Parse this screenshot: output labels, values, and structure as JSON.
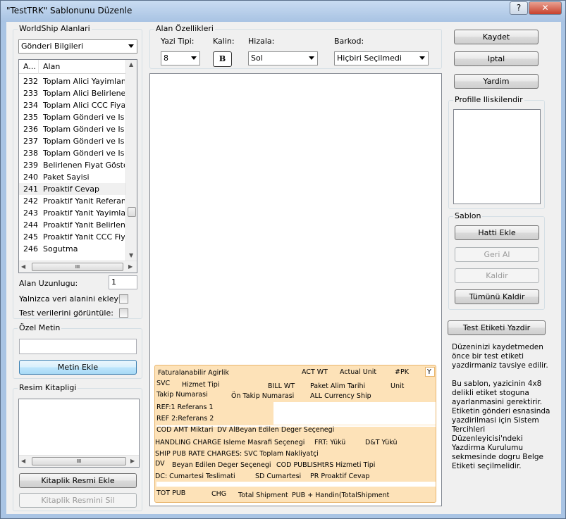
{
  "window": {
    "title": "\"TestTRK\" Sablonunu Düzenle",
    "help_btn": "?",
    "close_btn": "✕"
  },
  "worldship": {
    "group_label": "WorldShip Alanlari",
    "dropdown_value": "Gönderi Bilgileri",
    "list": {
      "col_num": "A...",
      "col_name": "Alan",
      "rows": [
        {
          "num": "232",
          "name": "Toplam Alici Yayimlanmi..."
        },
        {
          "num": "233",
          "name": "Toplam Alici Belirlenen F"
        },
        {
          "num": "234",
          "name": "Toplam Alici CCC Fiyatla"
        },
        {
          "num": "235",
          "name": "Toplam Gönderi ve Isle..."
        },
        {
          "num": "236",
          "name": "Toplam Gönderi ve Isle..."
        },
        {
          "num": "237",
          "name": "Toplam Gönderi ve Isle..."
        },
        {
          "num": "238",
          "name": "Toplam Gönderi ve Isle..."
        },
        {
          "num": "239",
          "name": "Belirlenen Fiyat Gösterge"
        },
        {
          "num": "240",
          "name": "Paket Sayisi"
        },
        {
          "num": "241",
          "name": "Proaktif Cevap"
        },
        {
          "num": "242",
          "name": "Proaktif Yanit Referans ..."
        },
        {
          "num": "243",
          "name": "Proaktif Yanit Yayimlanm"
        },
        {
          "num": "244",
          "name": "Proaktif Yanit Belirlenen"
        },
        {
          "num": "245",
          "name": "Proaktif Yanit CCC Fiyatl"
        },
        {
          "num": "246",
          "name": "Sogutma"
        }
      ]
    },
    "hscroll_grip": "III",
    "length_label": "Alan Uzunlugu:",
    "length_value": "1",
    "data_only_label": "Yalnizca veri alanini ekleyin:",
    "show_test_label": "Test verilerini görüntüle:"
  },
  "custom_text": {
    "group_label": "Özel Metin",
    "value": "",
    "add_button": "Metin Ekle"
  },
  "image_library": {
    "group_label": "Resim Kitapligi",
    "hscroll_grip": "III",
    "add_button": "Kitaplik Resmi Ekle",
    "delete_button": "Kitaplik Resmini Sil"
  },
  "field_props": {
    "group_label": "Alan Özellikleri",
    "font_label": "Yazi Tipi:",
    "font_value": "8",
    "bold_label": "Kalin:",
    "bold_glyph": "B",
    "align_label": "Hizala:",
    "align_value": "Sol",
    "barcode_label": "Barkod:",
    "barcode_value": "Hiçbiri Seçilmedi"
  },
  "label_fields": [
    "Faturalanabilir Agirlik",
    "ACT WT",
    "Actual Unit",
    "#PK",
    "Y",
    "SVC",
    "Hizmet Tipi",
    "BILL WT",
    "Paket Alim Tarihi",
    "Unit",
    "Takip Numarasi",
    "Ön Takip Numarasi",
    "ALL Currency Ship",
    "REF:1 Referans 1",
    "REF 2:Referans 2",
    "COD AMT Miktari",
    "DV AlBeyan Edilen Deger Seçenegi",
    "HANDLING CHARGE Isleme Masrafi Seçenegi",
    "FRT: Yükü",
    "D&T Yükü",
    "SHIP PUB RATE CHARGES: SVC Toplam Nakliyatçi",
    "DV",
    "Beyan Edilen Deger Seçenegi",
    "COD PUBLISHtRS Hizmeti Tipi",
    "DC: Cumartesi Teslimati",
    "SD Cumartesi",
    "PR Proaktif Cevap",
    "TOT PUB",
    "CHG",
    "Total Shipment",
    "PUB + Handin(TotalShipment"
  ],
  "right_panel": {
    "save": "Kaydet",
    "cancel": "Iptal",
    "help": "Yardim",
    "profiles_label": "Profille Iliskilendir",
    "template_group": "Sablon",
    "add_line": "Hatti Ekle",
    "undo": "Geri Al",
    "remove": "Kaldir",
    "remove_all": "Tümünü Kaldir",
    "print_test": "Test Etiketi Yazdir",
    "note1": "Düzeninizi kaydetmeden önce bir test etiketi yazdirmaniz tavsiye edilir.",
    "note2": "Bu sablon, yazicinin 4x8 delikli etiket stoguna ayarlanmasini gerektirir. Etiketin gönderi esnasinda yazdirilmasi için Sistem Tercihleri Düzenleyicisi'ndeki Yazdirma Kurulumu sekmesinde dogru Belge Etiketi seçilmelidir."
  }
}
